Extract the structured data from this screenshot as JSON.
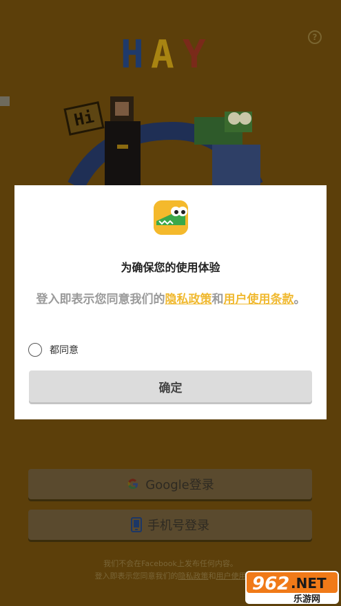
{
  "background": {
    "help_label": "?",
    "logo_letters": [
      "H",
      "A",
      "Y"
    ],
    "bubble_text": "Hi"
  },
  "dialog": {
    "title": "为确保您的使用体验",
    "body_prefix": "登入即表示您同意我们的",
    "privacy_link": "隐私政策",
    "connector": "和",
    "terms_link": "用户使用条款",
    "body_suffix": "。",
    "agree_label": "都同意",
    "confirm_label": "确定"
  },
  "login": {
    "google_label": "Google登录",
    "phone_label": "手机号登录"
  },
  "footer": {
    "line1": "我们不会在Facebook上发布任何内容。",
    "line2_prefix": "登入即表示您同意我们的",
    "privacy_link": "隐私政策",
    "connector": "和",
    "terms_link": "用户使用"
  },
  "watermark": {
    "brand": "962",
    "suffix": ".NET",
    "subtitle": "乐游网"
  },
  "colors": {
    "accent": "#f0b930",
    "background": "#5c3f0a",
    "dialog": "#ffffff",
    "confirm_button": "#dcdcdc"
  },
  "icons": [
    "help-icon",
    "app-crocodile-icon",
    "radio-icon",
    "google-icon",
    "phone-icon"
  ]
}
